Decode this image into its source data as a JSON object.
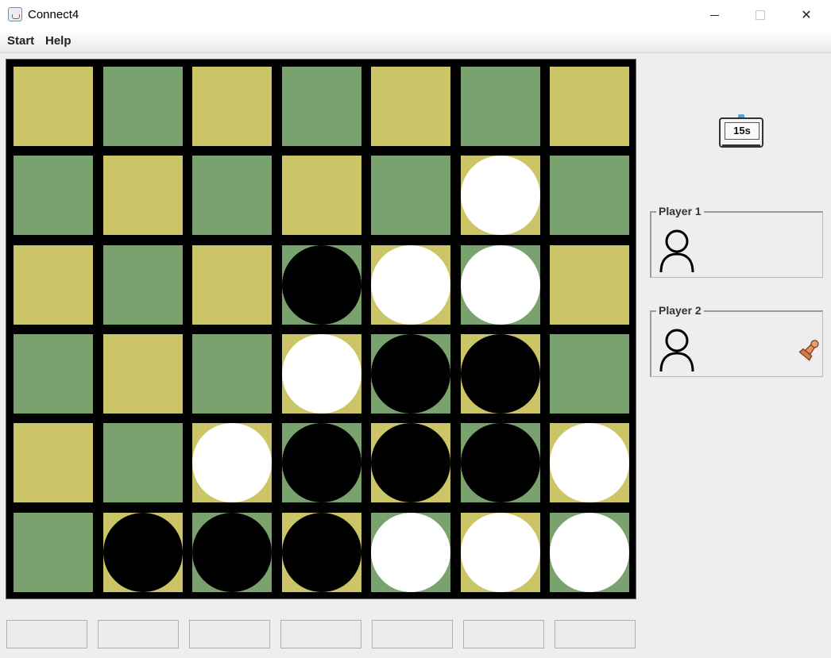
{
  "window": {
    "title": "Connect4",
    "controls": {
      "minimize": "minimize",
      "maximize": "maximize",
      "close": "✕"
    }
  },
  "menu": {
    "start_label": "Start",
    "help_label": "Help"
  },
  "timer": {
    "label": "15s"
  },
  "players": [
    {
      "title": "Player 1",
      "avatar_icon": "user-outline-icon",
      "is_turn": false
    },
    {
      "title": "Player 2",
      "avatar_icon": "user-outline-icon",
      "is_turn": true,
      "turn_icon": "chess-pawn-icon"
    }
  ],
  "board": {
    "rows": 6,
    "cols": 7,
    "colors": {
      "frame": "#000000",
      "tile_a": "#cbc567",
      "tile_b": "#7aa26f",
      "disc_white": "#ffffff",
      "disc_black": "#000000"
    },
    "grid": [
      [
        ".",
        ".",
        ".",
        ".",
        ".",
        ".",
        "."
      ],
      [
        ".",
        ".",
        ".",
        ".",
        ".",
        "W",
        "."
      ],
      [
        ".",
        ".",
        ".",
        "B",
        "W",
        "W",
        "."
      ],
      [
        ".",
        ".",
        ".",
        "W",
        "B",
        "B",
        "."
      ],
      [
        ".",
        ".",
        "W",
        "B",
        "B",
        "B",
        "W"
      ],
      [
        ".",
        "B",
        "B",
        "B",
        "W",
        "W",
        "W"
      ]
    ]
  },
  "column_buttons": [
    "",
    "",
    "",
    "",
    "",
    "",
    ""
  ]
}
